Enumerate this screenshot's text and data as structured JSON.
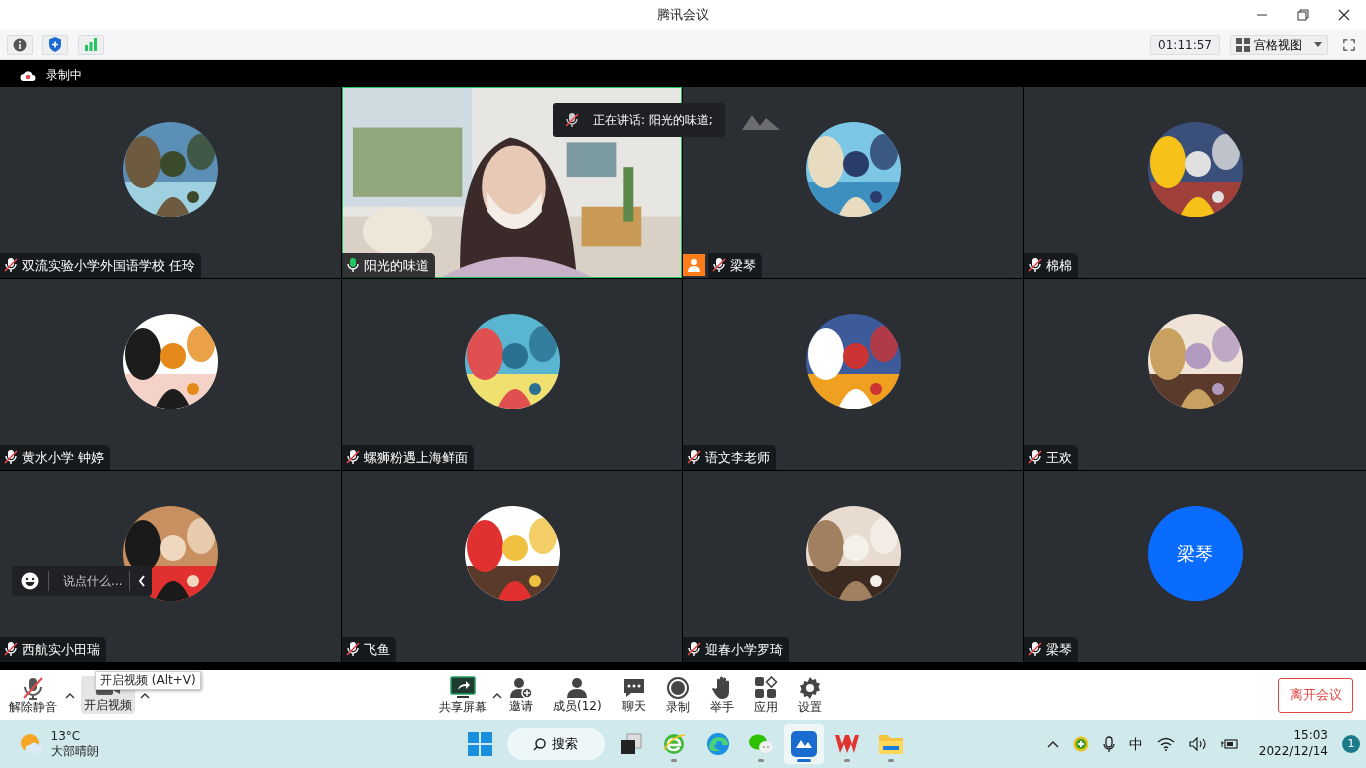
{
  "window": {
    "title": "腾讯会议"
  },
  "toolbar": {
    "timer": "01:11:57",
    "view": "宫格视图"
  },
  "recording": {
    "label": "录制中"
  },
  "speaking": {
    "text": "正在讲话: 阳光的味道;"
  },
  "tiles": [
    {
      "name": "双流实验小学外国语学校 任玲",
      "kind": "picture",
      "muted": true,
      "speaking": false,
      "host": false
    },
    {
      "name": "阳光的味道",
      "kind": "video",
      "muted": false,
      "speaking": true,
      "host": false
    },
    {
      "name": "梁琴",
      "kind": "picture",
      "muted": true,
      "speaking": false,
      "host": true
    },
    {
      "name": "棉棉",
      "kind": "picture",
      "muted": true,
      "speaking": false,
      "host": false
    },
    {
      "name": "黄水小学 钟婷",
      "kind": "picture",
      "muted": true,
      "speaking": false,
      "host": false
    },
    {
      "name": "螺狮粉遇上海鲜面",
      "kind": "picture",
      "muted": true,
      "speaking": false,
      "host": false
    },
    {
      "name": "语文李老师",
      "kind": "picture",
      "muted": true,
      "speaking": false,
      "host": false
    },
    {
      "name": "王欢",
      "kind": "picture",
      "muted": true,
      "speaking": false,
      "host": false
    },
    {
      "name": "西航实小田瑞",
      "kind": "picture",
      "muted": true,
      "speaking": false,
      "host": false
    },
    {
      "name": "飞鱼",
      "kind": "picture",
      "muted": true,
      "speaking": false,
      "host": false
    },
    {
      "name": "迎春小学罗琦",
      "kind": "picture",
      "muted": true,
      "speaking": false,
      "host": false
    },
    {
      "name": "梁琴",
      "kind": "initials",
      "initials": "梁琴",
      "muted": true,
      "speaking": false,
      "host": false
    }
  ],
  "chat": {
    "placeholder": "说点什么..."
  },
  "controls": [
    {
      "label": "解除静音",
      "kind": "mic",
      "caret": true,
      "hovered": false
    },
    {
      "label": "开启视频",
      "kind": "camera",
      "caret": true,
      "hovered": true
    },
    {
      "label": "共享屏幕",
      "kind": "share",
      "caret": true,
      "hovered": false
    },
    {
      "label": "邀请",
      "kind": "invite",
      "caret": false,
      "hovered": false
    },
    {
      "label": "成员(12)",
      "kind": "members",
      "caret": false,
      "hovered": false
    },
    {
      "label": "聊天",
      "kind": "chat",
      "caret": false,
      "hovered": false
    },
    {
      "label": "录制",
      "kind": "record",
      "caret": false,
      "hovered": false
    },
    {
      "label": "举手",
      "kind": "hand",
      "caret": false,
      "hovered": false
    },
    {
      "label": "应用",
      "kind": "apps",
      "caret": false,
      "hovered": false
    },
    {
      "label": "设置",
      "kind": "settings",
      "caret": false,
      "hovered": false
    }
  ],
  "tooltip": {
    "text": "开启视频 (Alt+V)"
  },
  "leave_button": "离开会议",
  "taskbar": {
    "temperature": "13°C",
    "weather": "大部晴朗",
    "search": "搜索",
    "apps": [
      {
        "kind": "taskview",
        "running": false,
        "selected": false
      },
      {
        "kind": "ie",
        "running": true,
        "selected": false
      },
      {
        "kind": "edge",
        "running": false,
        "selected": false
      },
      {
        "kind": "wechat",
        "running": true,
        "selected": false
      },
      {
        "kind": "meeting",
        "running": true,
        "selected": true
      },
      {
        "kind": "wps",
        "running": true,
        "selected": false
      },
      {
        "kind": "folder",
        "running": true,
        "selected": false
      }
    ],
    "input_method": "中",
    "time": "15:03",
    "date": "2022/12/14",
    "notifications": "1"
  }
}
